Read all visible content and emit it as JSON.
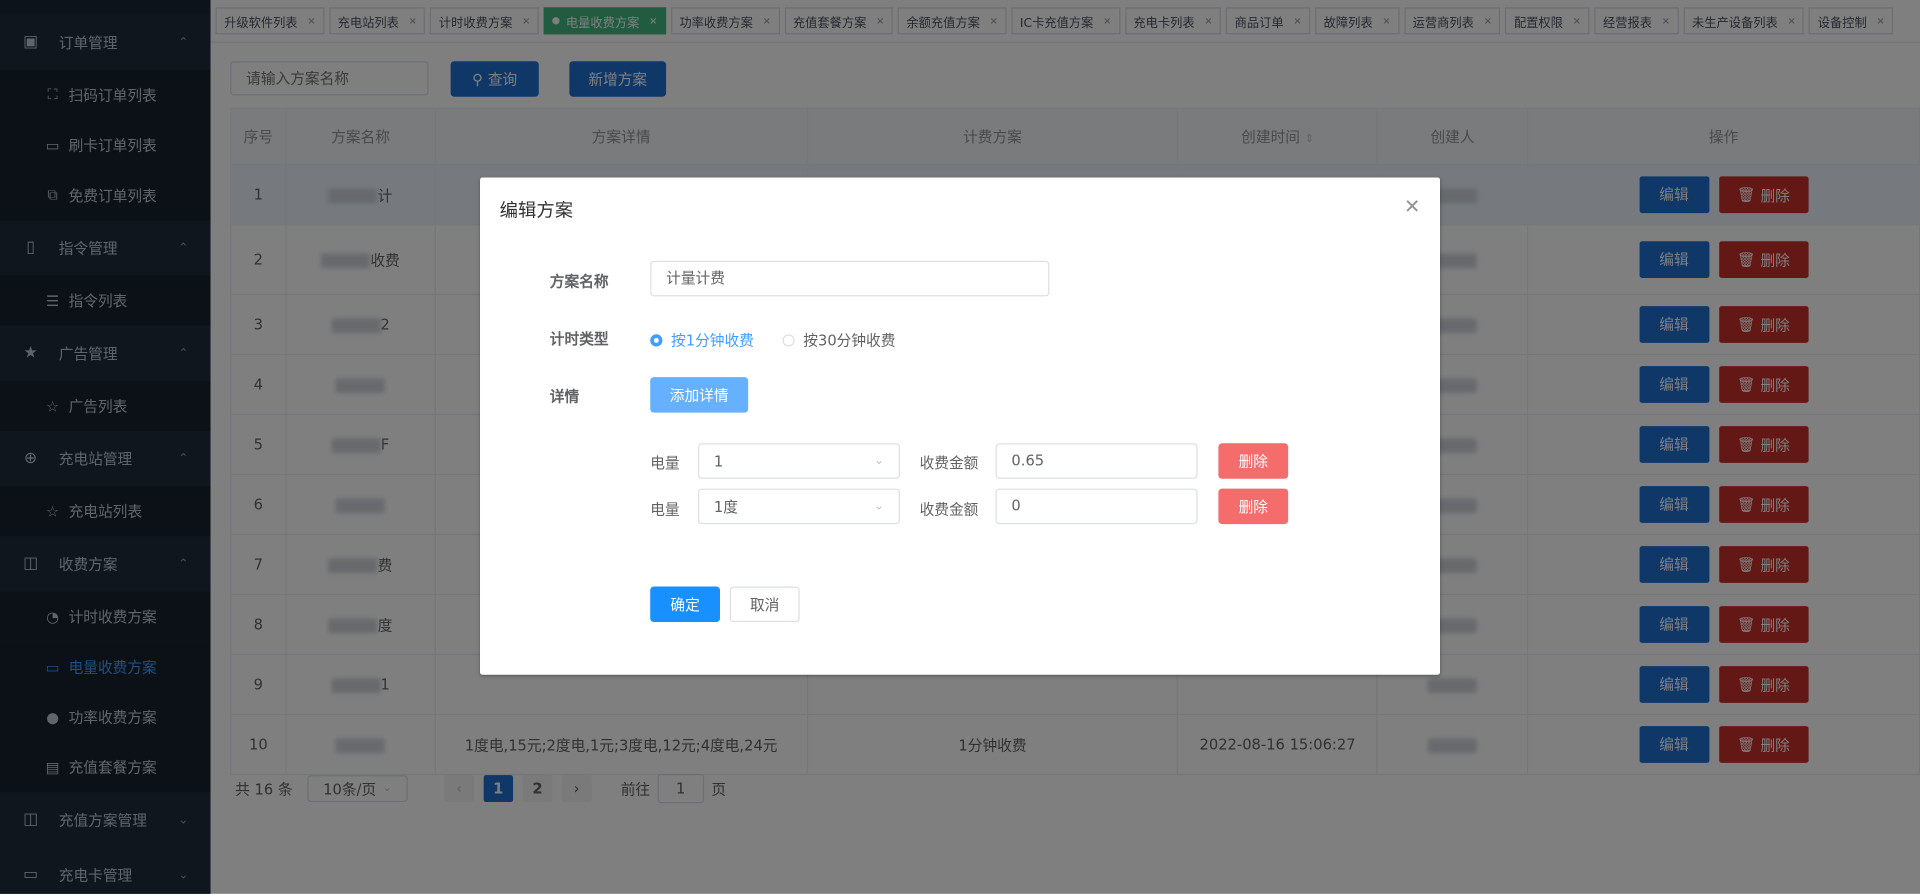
{
  "sidebar": {
    "groups": [
      {
        "label": "订单管理",
        "icon": "lock-icon",
        "items": [
          {
            "label": "扫码订单列表",
            "icon": "scan-icon"
          },
          {
            "label": "刷卡订单列表",
            "icon": "card-icon"
          },
          {
            "label": "免费订单列表",
            "icon": "coupon-icon"
          }
        ]
      },
      {
        "label": "指令管理",
        "icon": "book-icon",
        "items": [
          {
            "label": "指令列表",
            "icon": "list-icon"
          }
        ]
      },
      {
        "label": "广告管理",
        "icon": "star-icon",
        "items": [
          {
            "label": "广告列表",
            "icon": "star-outline-icon"
          }
        ]
      },
      {
        "label": "充电站管理",
        "icon": "plus-circle-icon",
        "items": [
          {
            "label": "充电站列表",
            "icon": "star-outline-icon"
          }
        ]
      },
      {
        "label": "收费方案",
        "icon": "book-open-icon",
        "items": [
          {
            "label": "计时收费方案",
            "icon": "clock-icon"
          },
          {
            "label": "电量收费方案",
            "icon": "monitor-icon",
            "active": true
          },
          {
            "label": "功率收费方案",
            "icon": "bulb-icon"
          },
          {
            "label": "充值套餐方案",
            "icon": "save-icon"
          }
        ]
      },
      {
        "label": "充值方案管理",
        "icon": "book-open-icon",
        "items": []
      },
      {
        "label": "充电卡管理",
        "icon": "wallet-icon",
        "items": []
      }
    ]
  },
  "tabs": [
    {
      "label": "升级软件列表"
    },
    {
      "label": "充电站列表"
    },
    {
      "label": "计时收费方案"
    },
    {
      "label": "电量收费方案",
      "active": true
    },
    {
      "label": "功率收费方案"
    },
    {
      "label": "充值套餐方案"
    },
    {
      "label": "余额充值方案"
    },
    {
      "label": "IC卡充值方案"
    },
    {
      "label": "充电卡列表"
    },
    {
      "label": "商品订单"
    },
    {
      "label": "故障列表"
    },
    {
      "label": "运营商列表"
    },
    {
      "label": "配置权限"
    },
    {
      "label": "经营报表"
    },
    {
      "label": "未生产设备列表"
    },
    {
      "label": "设备控制"
    }
  ],
  "toolbar": {
    "search_placeholder": "请输入方案名称",
    "query_label": "查询",
    "add_label": "新增方案"
  },
  "table": {
    "columns": [
      "序号",
      "方案名称",
      "方案详情",
      "计费方案",
      "创建时间",
      "创建人",
      "操作"
    ],
    "edit_label": "编辑",
    "delete_label": "删除",
    "rows": [
      {
        "no": "1",
        "name": "计",
        "detail": "",
        "plan": "",
        "time": "",
        "creator": ""
      },
      {
        "no": "2",
        "name": "收费",
        "detail": "",
        "plan": "",
        "time": "",
        "creator": ""
      },
      {
        "no": "3",
        "name": "2",
        "detail": "",
        "plan": "",
        "time": "",
        "creator": ""
      },
      {
        "no": "4",
        "name": "",
        "detail": "",
        "plan": "",
        "time": "",
        "creator": ""
      },
      {
        "no": "5",
        "name": "F",
        "detail": "",
        "plan": "",
        "time": "",
        "creator": ""
      },
      {
        "no": "6",
        "name": "",
        "detail": "",
        "plan": "",
        "time": "",
        "creator": ""
      },
      {
        "no": "7",
        "name": "费",
        "detail": "",
        "plan": "",
        "time": "",
        "creator": ""
      },
      {
        "no": "8",
        "name": "度",
        "detail": "",
        "plan": "",
        "time": "",
        "creator": ""
      },
      {
        "no": "9",
        "name": "1",
        "detail": "",
        "plan": "",
        "time": "",
        "creator": ""
      },
      {
        "no": "10",
        "name": "",
        "detail": "1度电,15元;2度电,1元;3度电,12元;4度电,24元",
        "plan": "1分钟收费",
        "time": "2022-08-16 15:06:27",
        "creator": ""
      }
    ]
  },
  "pager": {
    "total": "共 16 条",
    "page_size": "10条/页",
    "pages": [
      "1",
      "2"
    ],
    "current": "1",
    "goto_prefix": "前往",
    "goto_value": "1",
    "goto_suffix": "页"
  },
  "dialog": {
    "title": "编辑方案",
    "name_label": "方案名称",
    "name_value": "计量计费",
    "type_label": "计时类型",
    "type_options": [
      "按1分钟收费",
      "按30分钟收费"
    ],
    "type_selected": "按1分钟收费",
    "detail_label": "详情",
    "add_detail_label": "添加详情",
    "detail_rows": [
      {
        "qty_label": "电量",
        "qty_value": "1",
        "amount_label": "收费金额",
        "amount_value": "0.65",
        "delete_label": "删除"
      },
      {
        "qty_label": "电量",
        "qty_value": "1度",
        "amount_label": "收费金额",
        "amount_value": "0",
        "delete_label": "删除"
      }
    ],
    "confirm_label": "确定",
    "cancel_label": "取消"
  },
  "colors": {
    "primary": "#1e6fd0",
    "danger": "#c9302c",
    "active_tab": "#42b983",
    "sidebar": "#1f2d3d"
  }
}
